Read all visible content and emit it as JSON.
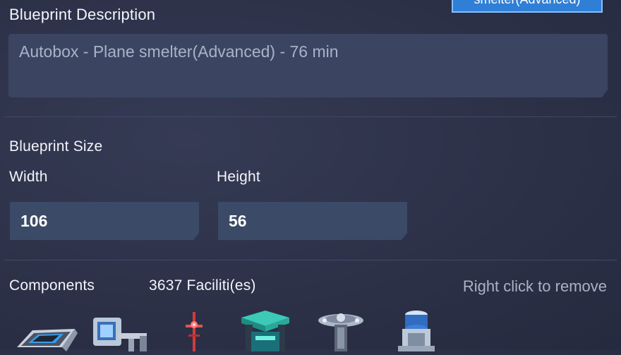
{
  "header": {
    "top_tag": "smelter(Advanced)"
  },
  "description": {
    "label": "Blueprint  Description",
    "value": "Autobox - Plane smelter(Advanced) - 76 min"
  },
  "size": {
    "label": "Blueprint Size",
    "width_label": "Width",
    "width_value": "106",
    "height_label": "Height",
    "height_value": "56"
  },
  "components": {
    "label": "Components",
    "count": "3637 Faciliti(es)",
    "hint": "Right click to remove",
    "items": [
      {
        "icon": "conveyor-belt-icon"
      },
      {
        "icon": "sorter-icon"
      },
      {
        "icon": "tesla-tower-icon"
      },
      {
        "icon": "assembler-icon"
      },
      {
        "icon": "smelter-icon"
      },
      {
        "icon": "storage-tank-icon"
      }
    ]
  },
  "colors": {
    "accent": "#2f7fd6",
    "input_bg": "#3b4a66",
    "panel_bg": "#2c3148"
  }
}
